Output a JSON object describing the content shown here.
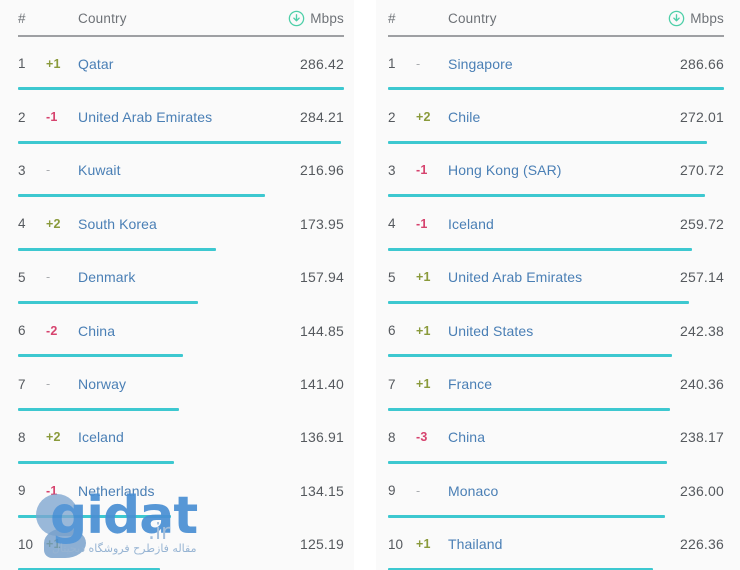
{
  "columns": {
    "rank": "#",
    "country": "Country",
    "speed": "Mbps",
    "speed_icon": "download-circle-icon"
  },
  "colors": {
    "bar": "#3DC8D0",
    "link": "#4A7FB5",
    "positive": "#8A9A3B",
    "negative": "#D6436E",
    "neutral": "#A9ACB0",
    "rule": "#9EA0A3",
    "background": "#FAFAFA"
  },
  "watermark": {
    "brand": "gidat",
    "tld": ".ir",
    "subtitle": "مقاله فازطرح فروشگاه دیجیتال"
  },
  "chart_data": {
    "type": "bar",
    "title": "",
    "xlabel": "",
    "ylabel": "Mbps",
    "panels": [
      {
        "name": "left-table",
        "max_value": 286.42,
        "categories": [
          "Qatar",
          "United Arab Emirates",
          "Kuwait",
          "South Korea",
          "Denmark",
          "China",
          "Norway",
          "Iceland",
          "Netherlands",
          ""
        ],
        "values": [
          286.42,
          284.21,
          216.96,
          173.95,
          157.94,
          144.85,
          141.4,
          136.91,
          134.15,
          125.19
        ]
      },
      {
        "name": "right-table",
        "max_value": 286.66,
        "categories": [
          "Singapore",
          "Chile",
          "Hong Kong (SAR)",
          "Iceland",
          "United Arab Emirates",
          "United States",
          "France",
          "China",
          "Monaco",
          "Thailand"
        ],
        "values": [
          286.66,
          272.01,
          270.72,
          259.72,
          257.14,
          242.38,
          240.36,
          238.17,
          236.0,
          226.36
        ]
      }
    ]
  },
  "left_table": {
    "rows": [
      {
        "rank": "1",
        "change": "+1",
        "dir": "up",
        "country": "Qatar",
        "value": "286.42",
        "pct": 100.0
      },
      {
        "rank": "2",
        "change": "-1",
        "dir": "down",
        "country": "United Arab Emirates",
        "value": "284.21",
        "pct": 99.2
      },
      {
        "rank": "3",
        "change": "-",
        "dir": "flat",
        "country": "Kuwait",
        "value": "216.96",
        "pct": 75.7
      },
      {
        "rank": "4",
        "change": "+2",
        "dir": "up",
        "country": "South Korea",
        "value": "173.95",
        "pct": 60.7
      },
      {
        "rank": "5",
        "change": "-",
        "dir": "flat",
        "country": "Denmark",
        "value": "157.94",
        "pct": 55.1
      },
      {
        "rank": "6",
        "change": "-2",
        "dir": "down",
        "country": "China",
        "value": "144.85",
        "pct": 50.6
      },
      {
        "rank": "7",
        "change": "-",
        "dir": "flat",
        "country": "Norway",
        "value": "141.40",
        "pct": 49.4
      },
      {
        "rank": "8",
        "change": "+2",
        "dir": "up",
        "country": "Iceland",
        "value": "136.91",
        "pct": 47.8
      },
      {
        "rank": "9",
        "change": "-1",
        "dir": "down",
        "country": "Netherlands",
        "value": "134.15",
        "pct": 46.8
      },
      {
        "rank": "10",
        "change": "+1",
        "dir": "up",
        "country": "",
        "value": "125.19",
        "pct": 43.7
      }
    ]
  },
  "right_table": {
    "rows": [
      {
        "rank": "1",
        "change": "-",
        "dir": "flat",
        "country": "Singapore",
        "value": "286.66",
        "pct": 100.0
      },
      {
        "rank": "2",
        "change": "+2",
        "dir": "up",
        "country": "Chile",
        "value": "272.01",
        "pct": 94.9
      },
      {
        "rank": "3",
        "change": "-1",
        "dir": "down",
        "country": "Hong Kong (SAR)",
        "value": "270.72",
        "pct": 94.4
      },
      {
        "rank": "4",
        "change": "-1",
        "dir": "down",
        "country": "Iceland",
        "value": "259.72",
        "pct": 90.6
      },
      {
        "rank": "5",
        "change": "+1",
        "dir": "up",
        "country": "United Arab Emirates",
        "value": "257.14",
        "pct": 89.7
      },
      {
        "rank": "6",
        "change": "+1",
        "dir": "up",
        "country": "United States",
        "value": "242.38",
        "pct": 84.6
      },
      {
        "rank": "7",
        "change": "+1",
        "dir": "up",
        "country": "France",
        "value": "240.36",
        "pct": 83.9
      },
      {
        "rank": "8",
        "change": "-3",
        "dir": "down",
        "country": "China",
        "value": "238.17",
        "pct": 83.1
      },
      {
        "rank": "9",
        "change": "-",
        "dir": "flat",
        "country": "Monaco",
        "value": "236.00",
        "pct": 82.3
      },
      {
        "rank": "10",
        "change": "+1",
        "dir": "up",
        "country": "Thailand",
        "value": "226.36",
        "pct": 79.0
      }
    ]
  }
}
